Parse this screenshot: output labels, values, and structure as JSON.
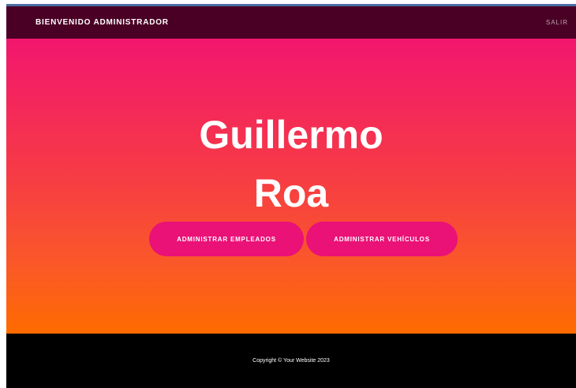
{
  "navbar": {
    "brand": "BIENVENIDO ADMINISTRADOR",
    "logout": "SALIR"
  },
  "hero": {
    "title_line1": "Guillermo",
    "title_line2": "Roa",
    "buttons": [
      {
        "label": "ADMINISTRAR EMPLEADOS"
      },
      {
        "label": "ADMINISTRAR VEHÍCULOS"
      }
    ]
  },
  "footer": {
    "copyright": "Copyright © Your Website 2023"
  },
  "colors": {
    "navbar_bg": "#4a0024",
    "gradient_top": "#f2166e",
    "gradient_bottom": "#ff6b00",
    "button_bg": "#ea1177",
    "footer_bg": "#000000"
  }
}
